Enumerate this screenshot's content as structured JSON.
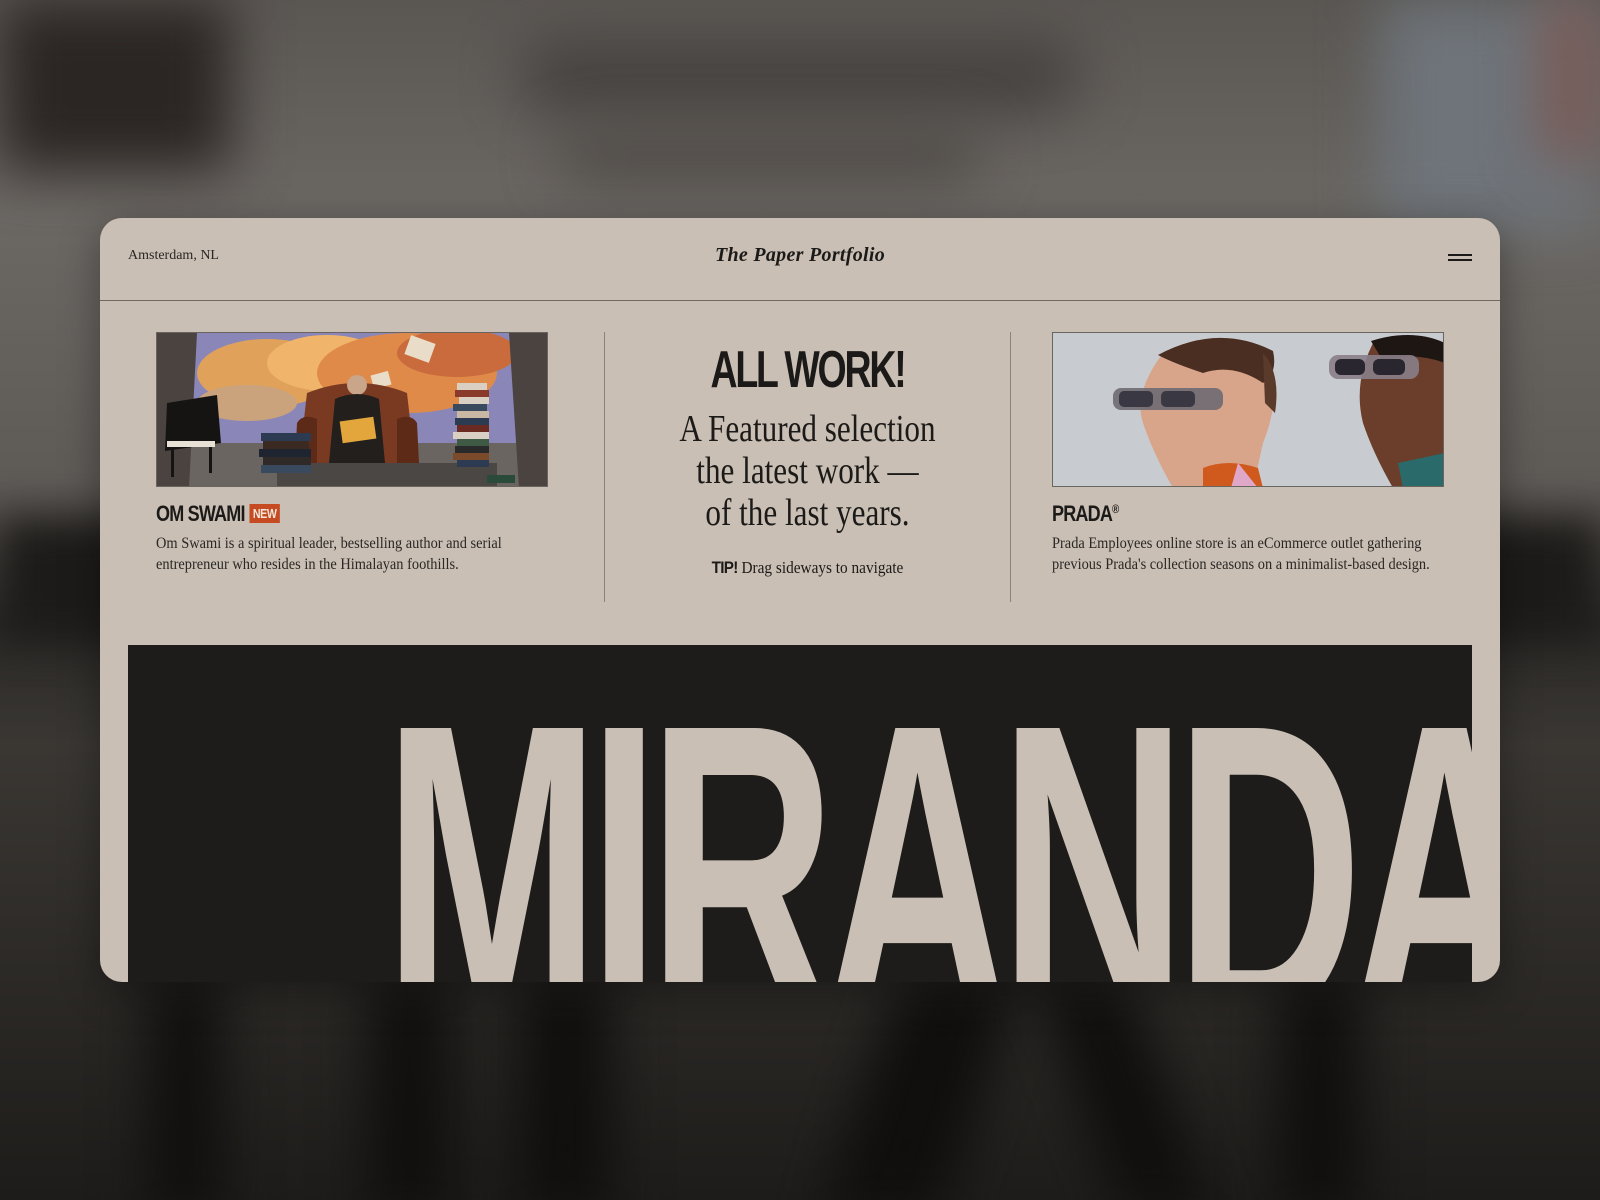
{
  "header": {
    "location": "Amsterdam, NL",
    "brand": "The Paper Portfolio",
    "menu_icon": "hamburger-icon"
  },
  "works": [
    {
      "title": "OM SWAMI",
      "badge": "NEW",
      "description": "Om Swami is a spiritual leader, bestselling author and serial entrepreneur who resides in the Himalayan foothills."
    },
    {
      "title": "PRADA",
      "title_mark": "®",
      "description": "Prada Employees online store is an eCommerce outlet gathering previous Prada's collection seasons on a minimalist-based design."
    }
  ],
  "intro": {
    "heading": "ALL WORK!",
    "lede_line1": "A Featured selection",
    "lede_line2": "the latest work —",
    "lede_line3": "of the last years.",
    "tip_label": "TIP!",
    "tip_text": "Drag sideways to navigate"
  },
  "feature": {
    "word": "MIRANDA"
  },
  "colors": {
    "paper": "#c9bfb4",
    "ink": "#1c1a18",
    "badge": "#c64a22",
    "feature_bg": "#1d1c1a"
  }
}
